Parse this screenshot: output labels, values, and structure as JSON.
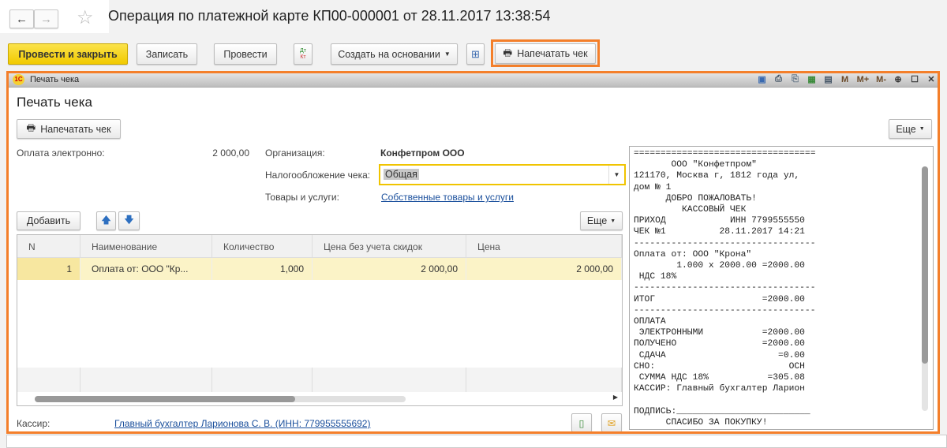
{
  "header": {
    "title": "Операция по платежной карте КП00-000001 от 28.11.2017 13:38:54",
    "back_icon": "←",
    "forward_icon": "→",
    "star_icon": "☆"
  },
  "toolbar": {
    "post_close": "Провести и закрыть",
    "save": "Записать",
    "post": "Провести",
    "dtkt_top": "Дт",
    "dtkt_bottom": "Кт",
    "create_based": "Создать на основании",
    "print_receipt": "Напечатать чек"
  },
  "window": {
    "title": "Печать чека",
    "logo": "1С",
    "tools": [
      "M",
      "M+",
      "M-"
    ],
    "heading": "Печать чека",
    "print_button": "Напечатать чек",
    "more": "Еще",
    "payment_label": "Оплата электронно:",
    "payment_value": "2 000,00",
    "org_label": "Организация:",
    "org_value": "Конфетпром ООО",
    "tax_label": "Налогообложение чека:",
    "tax_value": "Общая",
    "goods_label": "Товары и услуги:",
    "goods_value": "Собственные товары и услуги",
    "add": "Добавить",
    "more2": "Еще",
    "table": {
      "headers": [
        "N",
        "Наименование",
        "Количество",
        "Цена без учета скидок",
        "Цена"
      ],
      "rows": [
        [
          "1",
          "Оплата от: ООО \"Кр...",
          "1,000",
          "2 000,00",
          "2 000,00"
        ]
      ]
    },
    "cashier_label": "Кассир:",
    "cashier_value": "Главный бухгалтер Ларионова С. В. (ИНН: 779955555692)",
    "receipt": "==================================\n       ООО \"Конфетпром\"\n121170, Москва г, 1812 года ул,\nдом № 1\n      ДОБРО ПОЖАЛОВАТЬ!\n         КАССОВЫЙ ЧЕК\nПРИХОД            ИНН 7799555550\nЧЕК №1          28.11.2017 14:21\n----------------------------------\nОплата от: ООО \"Крона\"\n        1.000 x 2000.00 =2000.00\n НДС 18%\n----------------------------------\nИТОГ                    =2000.00\n----------------------------------\nОПЛАТА\n ЭЛЕКТРОННЫМИ           =2000.00\nПОЛУЧЕНО                =2000.00\n СДАЧА                     =0.00\nСНО:                         ОСН\n СУММА НДС 18%           =305.08\nКАССИР: Главный бухгалтер Ларион\n\nПОДПИСЬ:_________________________\n      СПАСИБО ЗА ПОКУПКУ!"
  },
  "colors": {
    "accent": "#f47f2a",
    "primary_button": "#f1ca00",
    "selected_row": "#fbf3c7",
    "link": "#1a4f9c"
  }
}
